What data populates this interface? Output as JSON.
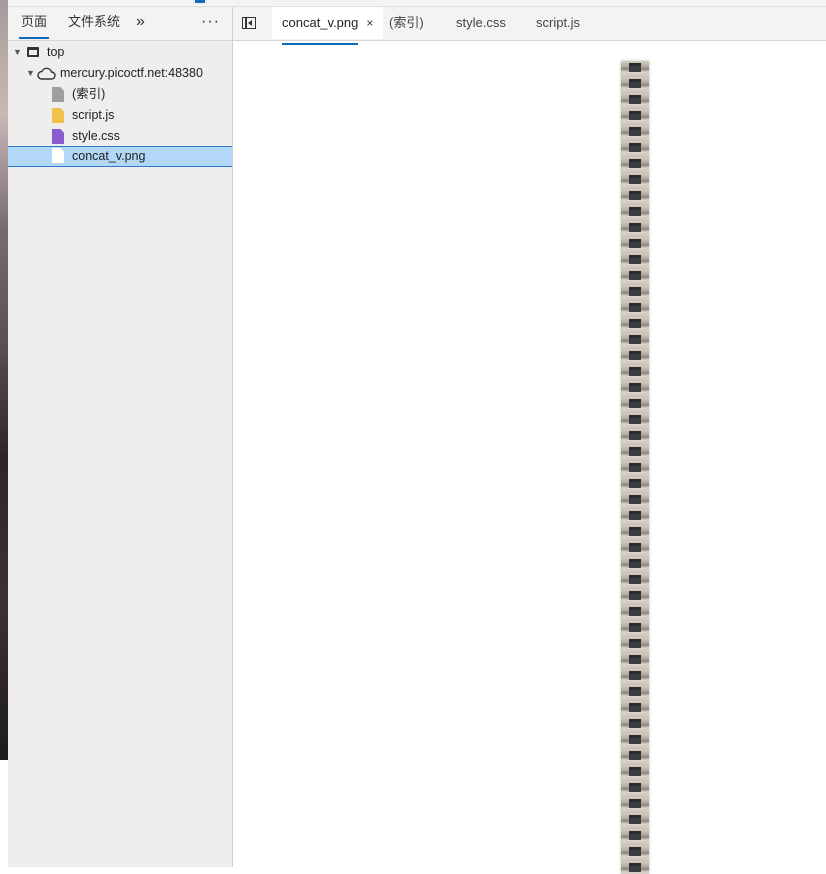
{
  "sidebar": {
    "tabs": {
      "page": "页面",
      "filesystem": "文件系统",
      "more": "»",
      "menu": "···"
    },
    "tree": [
      {
        "label": "top",
        "kind": "frame",
        "expanded": true
      },
      {
        "label": "mercury.picoctf.net:48380",
        "kind": "origin",
        "expanded": true
      },
      {
        "label": "(索引)",
        "kind": "document",
        "color": "#9e9e9e"
      },
      {
        "label": "script.js",
        "kind": "script",
        "color": "#f0c24a"
      },
      {
        "label": "style.css",
        "kind": "stylesheet",
        "color": "#8a5cd1"
      },
      {
        "label": "concat_v.png",
        "kind": "image",
        "color": "#ffffff",
        "selected": true
      }
    ]
  },
  "editor": {
    "tabs": [
      {
        "label": "concat_v.png",
        "active": true,
        "closable": true,
        "close_glyph": "×"
      },
      {
        "label": "(索引)",
        "active": false
      },
      {
        "label": "style.css",
        "active": false
      },
      {
        "label": "script.js",
        "active": false
      }
    ]
  },
  "colors": {
    "accent": "#0f6cbd",
    "selection": "#b3d7f8"
  }
}
